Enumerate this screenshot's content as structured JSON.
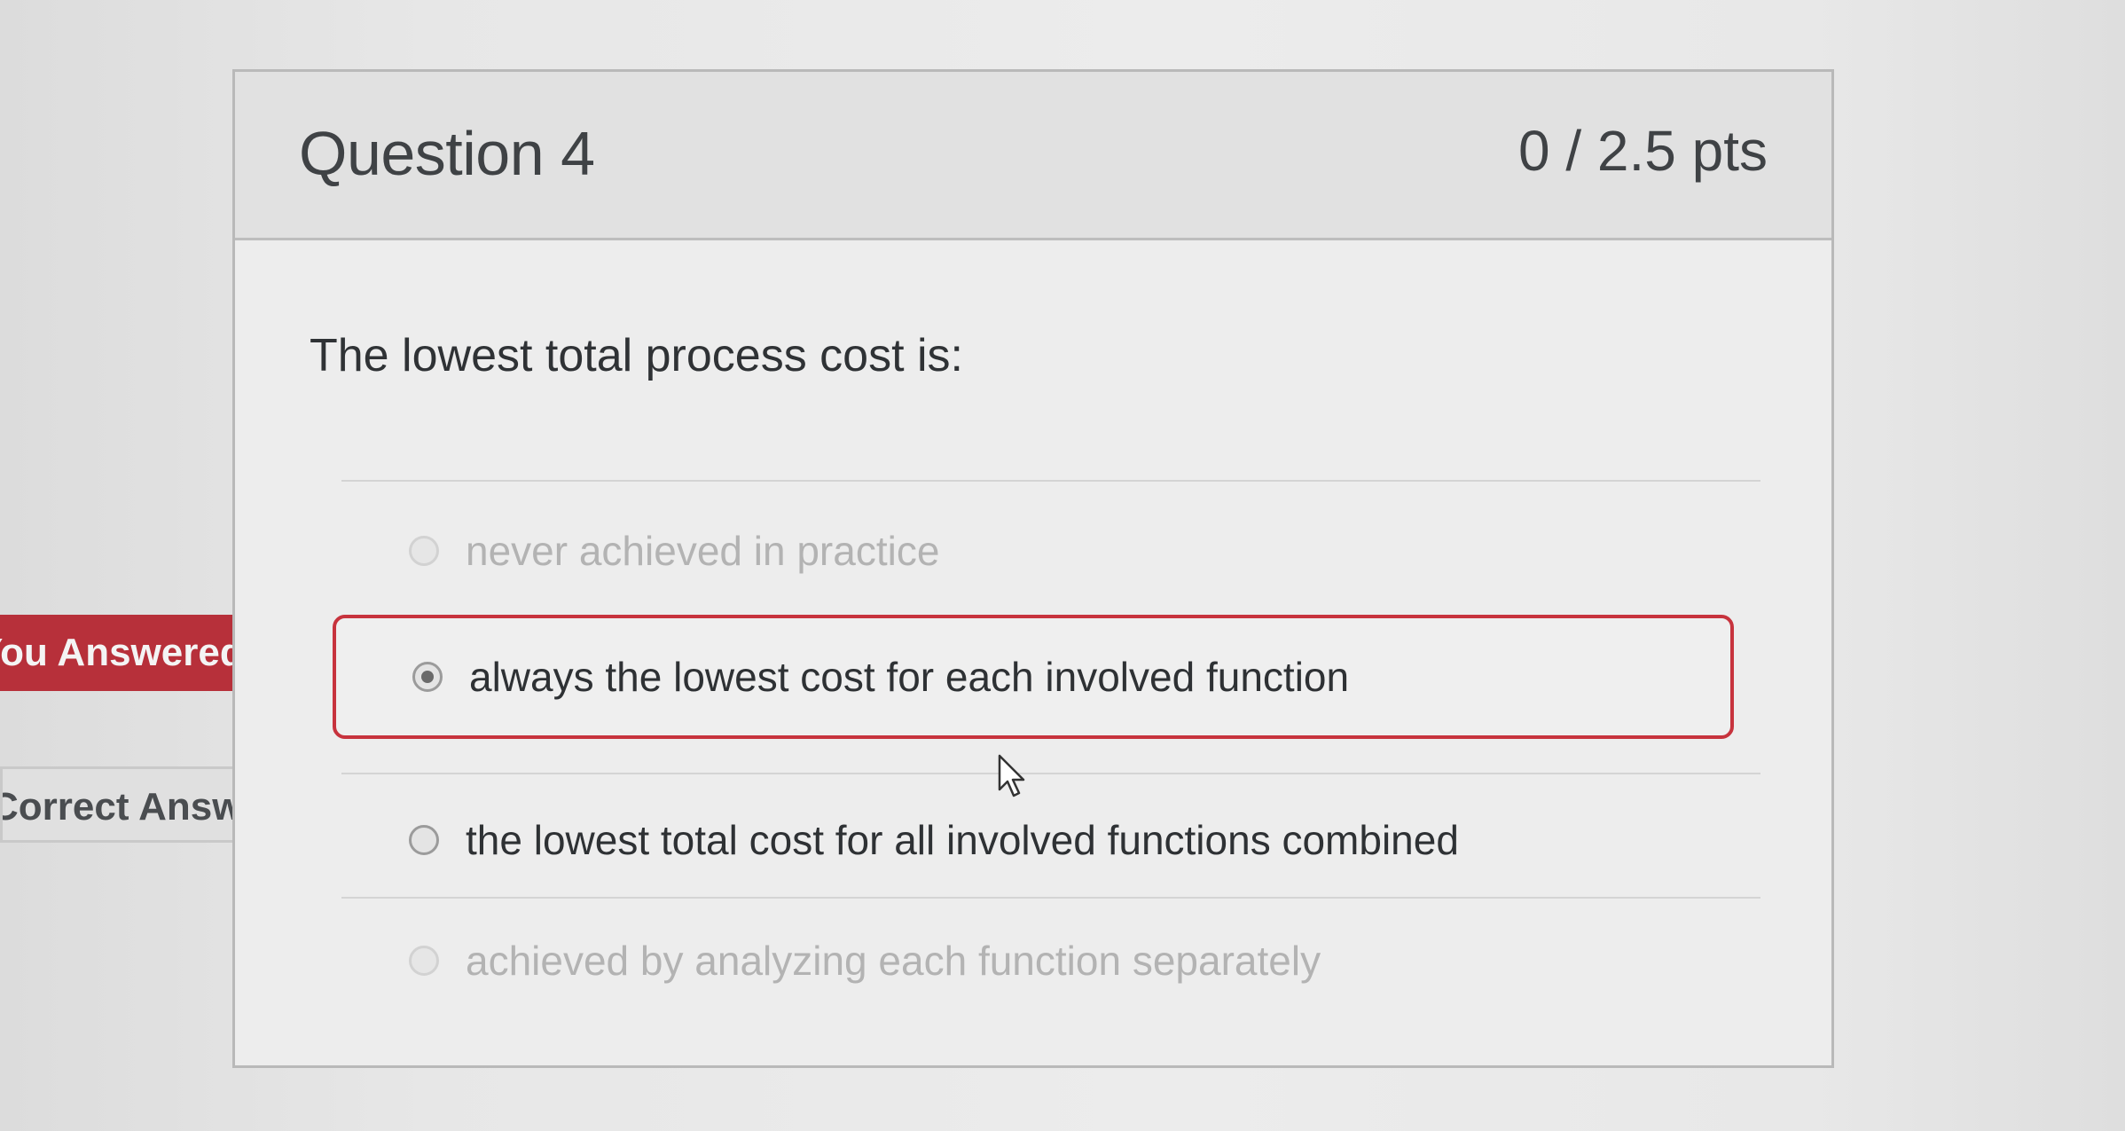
{
  "question": {
    "title": "Question 4",
    "points": "0 / 2.5 pts",
    "prompt": "The lowest total process cost is:"
  },
  "answers": [
    {
      "label": "never achieved in practice",
      "state": "unselected"
    },
    {
      "label": "always the lowest cost for each involved function",
      "state": "selected"
    },
    {
      "label": "the lowest total cost for all involved functions combined",
      "state": "correct"
    },
    {
      "label": "achieved by analyzing each function separately",
      "state": "unselected"
    }
  ],
  "flags": {
    "you_answered": "You Answered",
    "correct_answer": "Correct Answer"
  },
  "colors": {
    "incorrect_accent": "#c7333d",
    "card_background": "#ededed",
    "header_background": "#e1e1e1"
  },
  "icons": {
    "cursor": "mouse-pointer-icon",
    "radio": "radio-button-icon"
  }
}
